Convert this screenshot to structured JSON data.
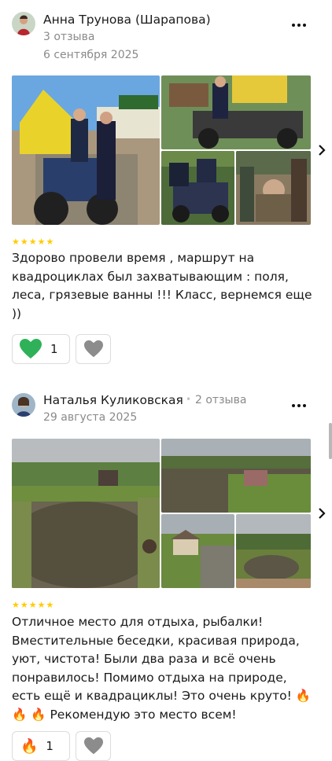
{
  "reviews": [
    {
      "author": "Анна Трунова (Шарапова)",
      "reviews_count": "3 отзыва",
      "date": "6 сентября 2025",
      "rating": 5,
      "text": "Здорово провели время , маршрут на квадроциклах был захватывающим : поля, леса, грязевые ванны !!! Класс, вернемся еще ))",
      "likes": "1",
      "like_icon": "green-heart-icon"
    },
    {
      "author": "Наталья Куликовская",
      "separator": "•",
      "reviews_count": "2 отзыва",
      "date": "29 августа 2025",
      "rating": 5,
      "text": "Отличное место для отдыха, рыбалки! Вместительные беседки, красивая природа, уют, чистота! Были два раза и всё очень понравилось! Помимо отдыха на природе, есть ещё и квадрациклы! Это очень круто! 🔥🔥 🔥 Рекомендую это место всем!",
      "likes": "1",
      "like_icon": "fire-icon"
    }
  ],
  "colors": {
    "star": "#ffcc00",
    "muted": "#8a8a8a",
    "border": "#dcdcdc",
    "heart_green": "#2fb15a"
  }
}
